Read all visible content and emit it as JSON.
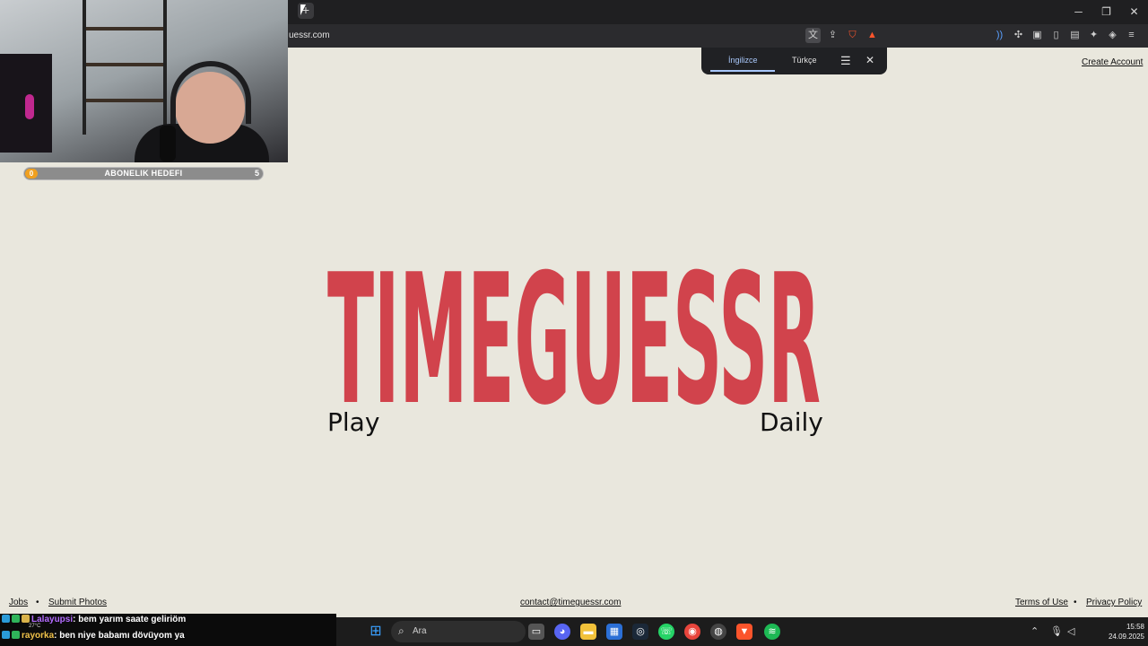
{
  "browser": {
    "url": "uessr.com",
    "new_tab_glyph": "+",
    "window_controls": [
      "─",
      "❐",
      "✕"
    ]
  },
  "translate_popup": {
    "lang_from": "İngilizce",
    "lang_to": "Türkçe"
  },
  "header": {
    "create_account": "Create Account"
  },
  "overlay": {
    "sub_goal_label": "ABONELIK HEDEFI",
    "sub_goal_current": "0",
    "sub_goal_target": "5"
  },
  "main": {
    "logo_text": "TIMEGUESSR",
    "logo_color": "#d1434c",
    "play_label": "Play",
    "daily_label": "Daily"
  },
  "footer": {
    "jobs": "Jobs",
    "separator": "•",
    "submit_photos": "Submit Photos",
    "contact": "contact@timeguessr.com",
    "terms": "Terms of Use",
    "privacy": "Privacy Policy"
  },
  "chat": {
    "messages": [
      {
        "user": "Lalayupsi",
        "text": ": bem yarım saate geliriöm",
        "color": "#b36bff"
      },
      {
        "user": "rayorka",
        "text": ": ben niye babamı dövüyom ya",
        "color": "#f0c24a"
      }
    ],
    "weather": "27°C"
  },
  "taskbar": {
    "search_placeholder": "Ara",
    "time": "15:58",
    "date": "24.09.2025"
  }
}
